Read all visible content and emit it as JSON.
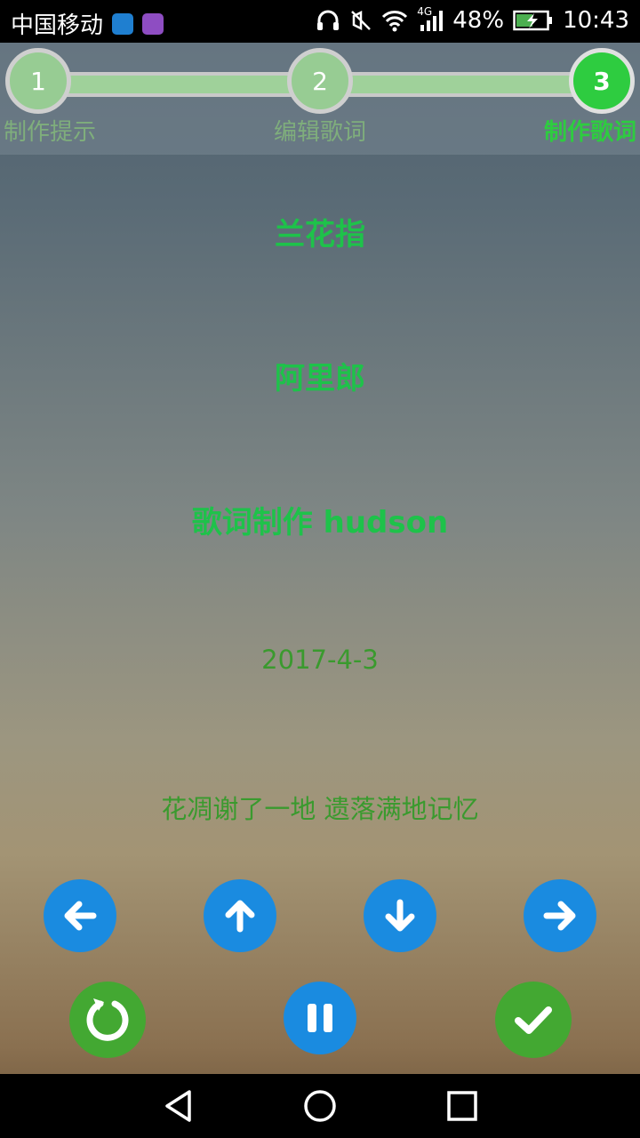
{
  "status_bar": {
    "carrier": "中国移动",
    "network": "4G",
    "battery": "48%",
    "time": "10:43"
  },
  "stepper": {
    "steps": [
      {
        "number": "1",
        "label": "制作提示"
      },
      {
        "number": "2",
        "label": "编辑歌词"
      },
      {
        "number": "3",
        "label": "制作歌词"
      }
    ],
    "current_step": 3
  },
  "lyrics": {
    "title": "兰花指",
    "artist": "阿里郎",
    "maker": "歌词制作 hudson",
    "date": "2017-4-3",
    "current_line": "花凋谢了一地 遗落满地记忆"
  },
  "controls": {
    "row1": [
      "back-arrow-icon",
      "up-arrow-icon",
      "down-arrow-icon",
      "forward-arrow-icon"
    ],
    "row2": [
      "restart-icon",
      "pause-icon",
      "check-icon"
    ]
  },
  "colors": {
    "accent_green": "#2ecc40",
    "button_blue": "#1a8be0",
    "button_green": "#43a832"
  }
}
